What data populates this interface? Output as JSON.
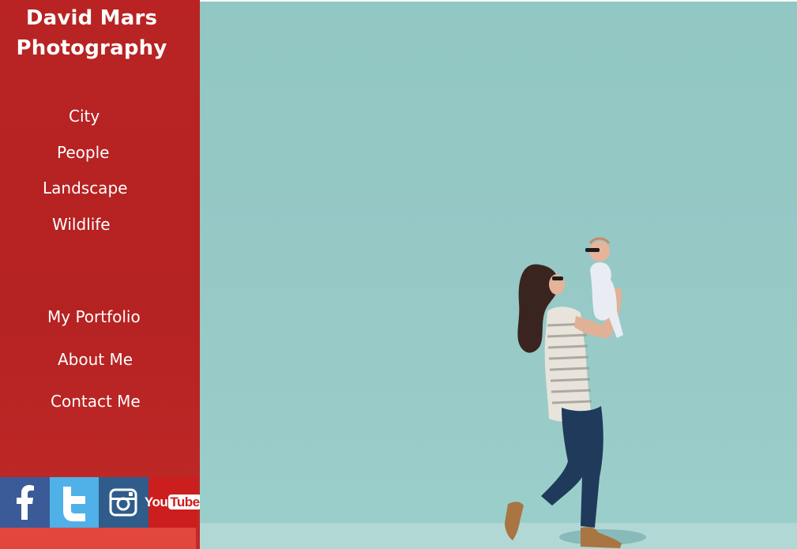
{
  "site": {
    "title_line1": "David Mars",
    "title_line2": "Photography"
  },
  "nav": {
    "categories": [
      {
        "label": "City"
      },
      {
        "label": "People"
      },
      {
        "label": "Landscape"
      },
      {
        "label": "Wildlife"
      }
    ],
    "pages": [
      {
        "label": "My Portfolio"
      },
      {
        "label": "About Me"
      },
      {
        "label": "Contact Me"
      }
    ]
  },
  "social": {
    "icons": [
      "facebook-icon",
      "twitter-icon",
      "instagram-icon",
      "youtube-icon"
    ],
    "youtube_you": "You",
    "youtube_tube": "Tube"
  },
  "colors": {
    "sidebar": "#b52222",
    "hero_background": "#97c9c6",
    "facebook": "#3b5b98",
    "twitter": "#4fb1e8",
    "instagram": "#2f5c8a",
    "youtube": "#cc1e1e"
  }
}
